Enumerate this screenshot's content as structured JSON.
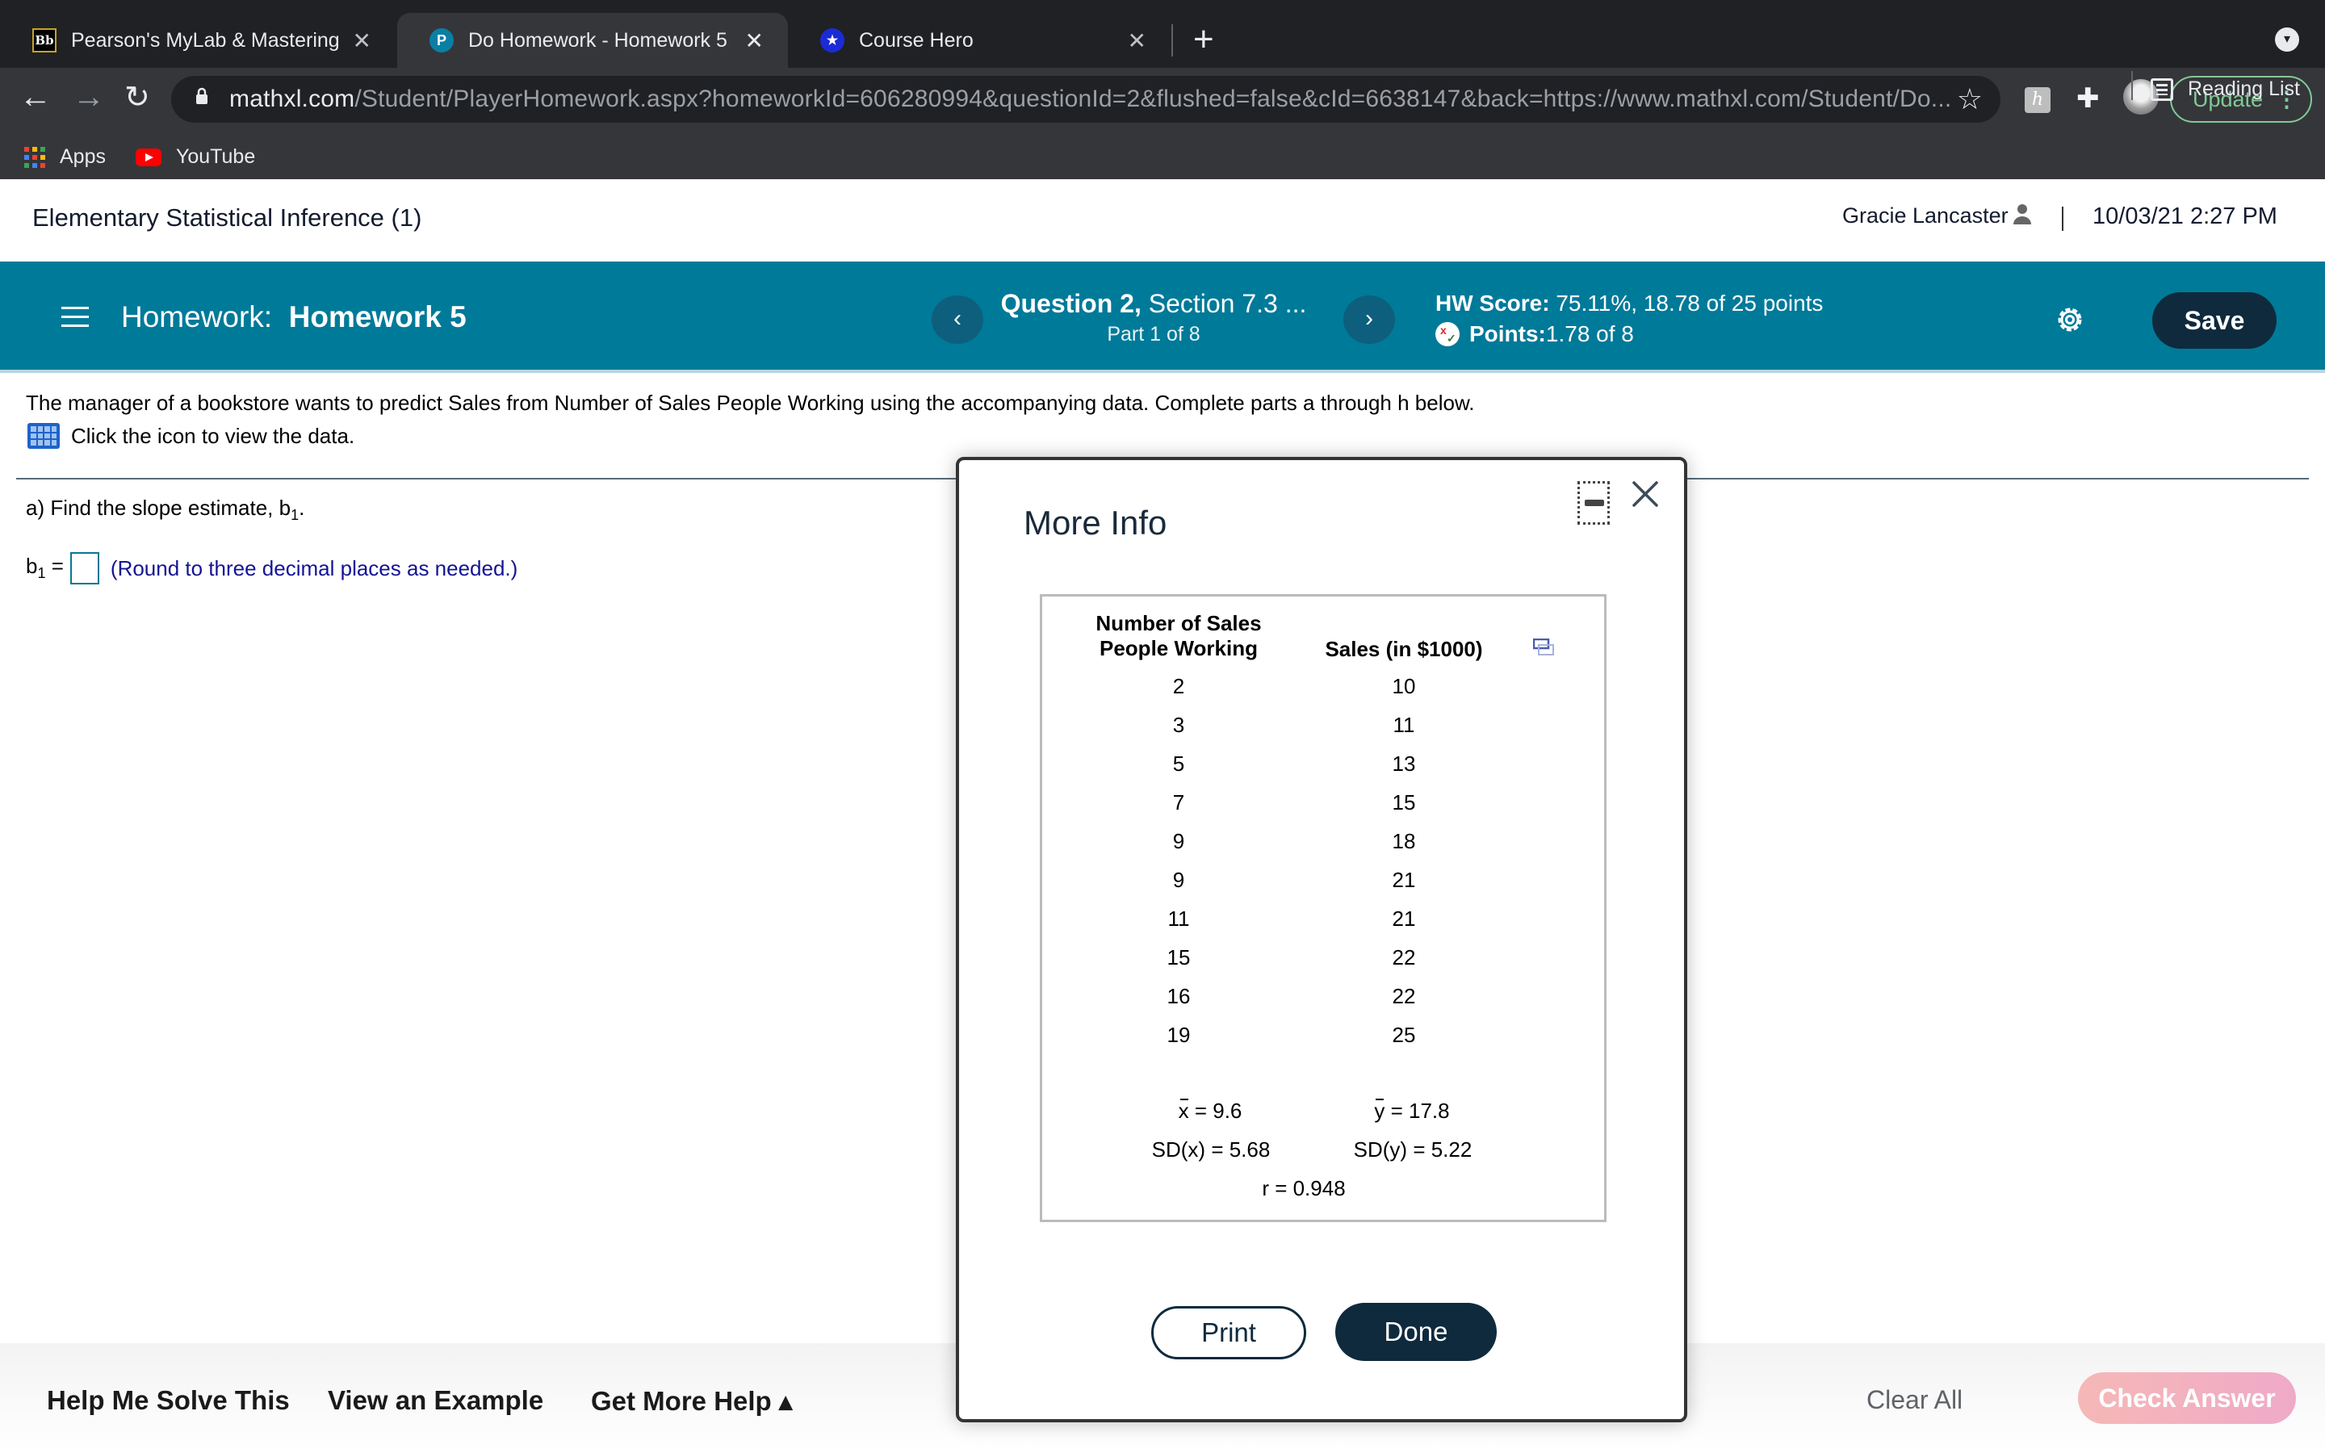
{
  "browser": {
    "tabs": [
      {
        "title": "Pearson's MyLab & Mastering",
        "favicon": "blackboard-icon",
        "active": false
      },
      {
        "title": "Do Homework - Homework 5",
        "favicon": "pearson-icon",
        "active": true
      },
      {
        "title": "Course Hero",
        "favicon": "coursehero-star-icon",
        "active": false
      }
    ],
    "url_host": "mathxl.com",
    "url_path": "/Student/PlayerHomework.aspx?homeworkId=606280994&questionId=2&flushed=false&cId=6638147&back=https://www.mathxl.com/Student/Do...",
    "update_label": "Update",
    "bookmarks": [
      {
        "label": "Apps",
        "icon": "apps-grid-icon"
      },
      {
        "label": "YouTube",
        "icon": "youtube-icon"
      }
    ],
    "reading_list_label": "Reading List"
  },
  "course": {
    "title": "Elementary Statistical Inference (1)",
    "user_name": "Gracie Lancaster",
    "datetime": "10/03/21 2:27 PM"
  },
  "hw_bar": {
    "homework_prefix": "Homework:",
    "homework_name": "Homework 5",
    "question_bold": "Question 2,",
    "question_section": " Section 7.3 ...",
    "part": "Part 1 of 8",
    "hw_score_label": "HW Score:",
    "hw_score_value": " 75.11%, 18.78 of 25 points",
    "points_label": "Points:",
    "points_value": " 1.78 of 8",
    "save_label": "Save",
    "colors": {
      "bar": "#007a99",
      "save": "#0f2a3d"
    }
  },
  "question": {
    "prompt": "The manager of a bookstore wants to predict Sales from Number of Sales People Working using the accompanying data. Complete parts a through h below.",
    "data_link": "Click the icon to view the data.",
    "part_a_text": "a) Find the slope estimate, b",
    "part_a_sub": "1",
    "part_a_end": ".",
    "answer_label": "b",
    "answer_sub": "1",
    "answer_eq": " =",
    "answer_value": "",
    "hint": "(Round to three decimal places as needed.)"
  },
  "modal": {
    "title": "More Info",
    "col1_header_line1": "Number of Sales",
    "col1_header_line2": "People Working",
    "col2_header": "Sales (in $1000)",
    "rows": [
      {
        "x": "2",
        "y": "10"
      },
      {
        "x": "3",
        "y": "11"
      },
      {
        "x": "5",
        "y": "13"
      },
      {
        "x": "7",
        "y": "15"
      },
      {
        "x": "9",
        "y": "18"
      },
      {
        "x": "9",
        "y": "21"
      },
      {
        "x": "11",
        "y": "21"
      },
      {
        "x": "15",
        "y": "22"
      },
      {
        "x": "16",
        "y": "22"
      },
      {
        "x": "19",
        "y": "25"
      }
    ],
    "xbar_label": "x",
    "xbar_value": " = 9.6",
    "ybar_label": "y",
    "ybar_value": " = 17.8",
    "sdx": "SD(x) = 5.68",
    "sdy": "SD(y) = 5.22",
    "r": "r = 0.948",
    "print_label": "Print",
    "done_label": "Done"
  },
  "footer": {
    "help_solve": "Help Me Solve This",
    "view_example": "View an Example",
    "more_help": "Get More Help ▴",
    "clear_all": "Clear All",
    "check_answer": "Check Answer"
  }
}
